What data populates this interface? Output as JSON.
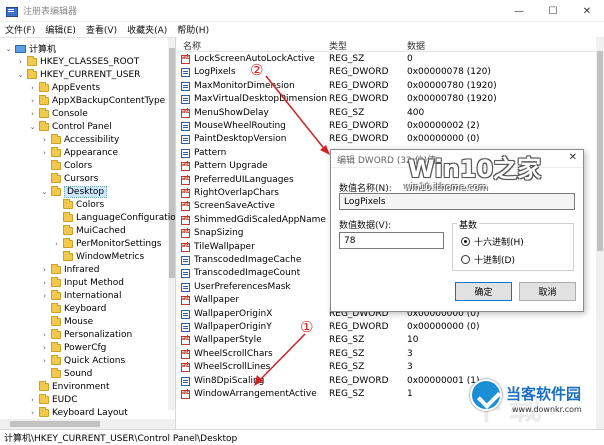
{
  "window": {
    "title": "注册表编辑器",
    "controls": [
      "—",
      "☐",
      "✕"
    ]
  },
  "menu": [
    "文件(F)",
    "编辑(E)",
    "查看(V)",
    "收藏夹(A)",
    "帮助(H)"
  ],
  "tree": [
    {
      "label": "计算机",
      "depth": 0,
      "expander": "⌄",
      "icon": "pc"
    },
    {
      "label": "HKEY_CLASSES_ROOT",
      "depth": 1,
      "expander": "›",
      "icon": "folder"
    },
    {
      "label": "HKEY_CURRENT_USER",
      "depth": 1,
      "expander": "⌄",
      "icon": "folder"
    },
    {
      "label": "AppEvents",
      "depth": 2,
      "expander": "›",
      "icon": "folder"
    },
    {
      "label": "AppXBackupContentType",
      "depth": 2,
      "expander": "›",
      "icon": "folder"
    },
    {
      "label": "Console",
      "depth": 2,
      "expander": "›",
      "icon": "folder"
    },
    {
      "label": "Control Panel",
      "depth": 2,
      "expander": "⌄",
      "icon": "folder"
    },
    {
      "label": "Accessibility",
      "depth": 3,
      "expander": "›",
      "icon": "folder"
    },
    {
      "label": "Appearance",
      "depth": 3,
      "expander": "›",
      "icon": "folder"
    },
    {
      "label": "Colors",
      "depth": 3,
      "expander": "",
      "icon": "folder"
    },
    {
      "label": "Cursors",
      "depth": 3,
      "expander": "",
      "icon": "folder"
    },
    {
      "label": "Desktop",
      "depth": 3,
      "expander": "⌄",
      "icon": "folder",
      "selected": true
    },
    {
      "label": "Colors",
      "depth": 4,
      "expander": "",
      "icon": "folder"
    },
    {
      "label": "LanguageConfiguratio",
      "depth": 4,
      "expander": "",
      "icon": "folder"
    },
    {
      "label": "MuiCached",
      "depth": 4,
      "expander": "",
      "icon": "folder"
    },
    {
      "label": "PerMonitorSettings",
      "depth": 4,
      "expander": "›",
      "icon": "folder"
    },
    {
      "label": "WindowMetrics",
      "depth": 4,
      "expander": "",
      "icon": "folder"
    },
    {
      "label": "Infrared",
      "depth": 3,
      "expander": "›",
      "icon": "folder"
    },
    {
      "label": "Input Method",
      "depth": 3,
      "expander": "›",
      "icon": "folder"
    },
    {
      "label": "International",
      "depth": 3,
      "expander": "›",
      "icon": "folder"
    },
    {
      "label": "Keyboard",
      "depth": 3,
      "expander": "",
      "icon": "folder"
    },
    {
      "label": "Mouse",
      "depth": 3,
      "expander": "",
      "icon": "folder"
    },
    {
      "label": "Personalization",
      "depth": 3,
      "expander": "›",
      "icon": "folder"
    },
    {
      "label": "PowerCfg",
      "depth": 3,
      "expander": "›",
      "icon": "folder"
    },
    {
      "label": "Quick Actions",
      "depth": 3,
      "expander": "›",
      "icon": "folder"
    },
    {
      "label": "Sound",
      "depth": 3,
      "expander": "",
      "icon": "folder"
    },
    {
      "label": "Environment",
      "depth": 2,
      "expander": "",
      "icon": "folder"
    },
    {
      "label": "EUDC",
      "depth": 2,
      "expander": "›",
      "icon": "folder"
    },
    {
      "label": "Keyboard Layout",
      "depth": 2,
      "expander": "›",
      "icon": "folder"
    }
  ],
  "list": {
    "headers": {
      "name": "名称",
      "type": "类型",
      "data": "数据"
    },
    "rows": [
      {
        "name": "LockScreenAutoLockActive",
        "type": "REG_SZ",
        "data": "0",
        "icon": "sz"
      },
      {
        "name": "LogPixels",
        "type": "REG_DWORD",
        "data": "0x00000078 (120)",
        "icon": "dw"
      },
      {
        "name": "MaxMonitorDimension",
        "type": "REG_DWORD",
        "data": "0x00000780 (1920)",
        "icon": "dw"
      },
      {
        "name": "MaxVirtualDesktopDimension",
        "type": "REG_DWORD",
        "data": "0x00000780 (1920)",
        "icon": "dw"
      },
      {
        "name": "MenuShowDelay",
        "type": "REG_SZ",
        "data": "400",
        "icon": "sz"
      },
      {
        "name": "MouseWheelRouting",
        "type": "REG_DWORD",
        "data": "0x00000002 (2)",
        "icon": "dw"
      },
      {
        "name": "PaintDesktopVersion",
        "type": "REG_DWORD",
        "data": "0x00000000 (0)",
        "icon": "dw"
      },
      {
        "name": "Pattern",
        "type": "",
        "data": "",
        "icon": "dw"
      },
      {
        "name": "Pattern Upgrade",
        "type": "",
        "data": "",
        "icon": "sz"
      },
      {
        "name": "PreferredUILanguages",
        "type": "",
        "data": "",
        "icon": "sz"
      },
      {
        "name": "RightOverlapChars",
        "type": "",
        "data": "",
        "icon": "sz"
      },
      {
        "name": "ScreenSaveActive",
        "type": "",
        "data": "",
        "icon": "sz"
      },
      {
        "name": "ShimmedGdiScaledAppName",
        "type": "",
        "data": "",
        "icon": "sz"
      },
      {
        "name": "SnapSizing",
        "type": "",
        "data": "",
        "icon": "sz"
      },
      {
        "name": "TileWallpaper",
        "type": "",
        "data": "",
        "icon": "sz"
      },
      {
        "name": "TranscodedImageCache",
        "type": "",
        "data": "",
        "icon": "dw"
      },
      {
        "name": "TranscodedImageCount",
        "type": "",
        "data": "",
        "icon": "dw"
      },
      {
        "name": "UserPreferencesMask",
        "type": "",
        "data": "",
        "icon": "dw"
      },
      {
        "name": "Wallpaper",
        "type": "",
        "data": "",
        "icon": "sz"
      },
      {
        "name": "WallpaperOriginX",
        "type": "REG_DWORD",
        "data": "0x00000000 (0)",
        "icon": "dw"
      },
      {
        "name": "WallpaperOriginY",
        "type": "REG_DWORD",
        "data": "0x00000000 (0)",
        "icon": "dw"
      },
      {
        "name": "WallpaperStyle",
        "type": "REG_SZ",
        "data": "10",
        "icon": "sz"
      },
      {
        "name": "WheelScrollChars",
        "type": "REG_SZ",
        "data": "3",
        "icon": "sz"
      },
      {
        "name": "WheelScrollLines",
        "type": "REG_SZ",
        "data": "3",
        "icon": "sz"
      },
      {
        "name": "Win8DpiScaling",
        "type": "REG_DWORD",
        "data": "0x00000001 (1)",
        "icon": "dw"
      },
      {
        "name": "WindowArrangementActive",
        "type": "REG_SZ",
        "data": "1",
        "icon": "sz"
      }
    ]
  },
  "status_path": "计算机\\HKEY_CURRENT_USER\\Control Panel\\Desktop",
  "dialog": {
    "title": "编辑 DWORD (32 位)值",
    "close": "✕",
    "name_label": "数值名称(N):",
    "name_value": "LogPixels",
    "data_label": "数值数据(V):",
    "data_value": "78",
    "base_label": "基数",
    "hex_label": "十六进制(H)",
    "dec_label": "十进制(D)",
    "ok": "确定",
    "cancel": "取消"
  },
  "callouts": {
    "one": "①",
    "two": "②",
    "arrow_color": "#d42020"
  },
  "watermarks": {
    "win10": "Win10之家",
    "win10_url": "win10.ithome.com",
    "site": "当客软件园",
    "site_url": "www.downkr.com",
    "faded": "下载"
  }
}
